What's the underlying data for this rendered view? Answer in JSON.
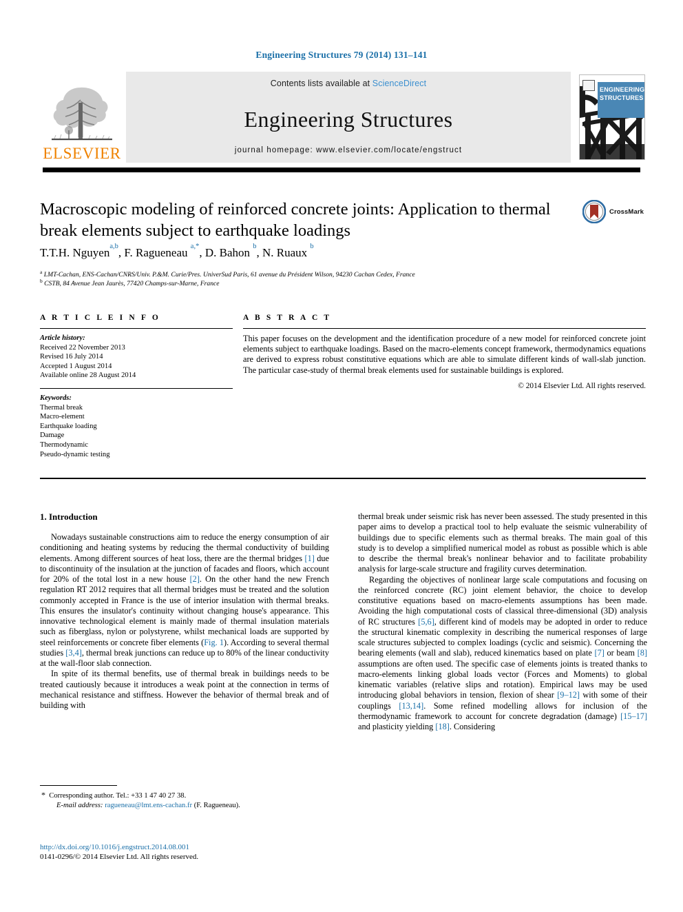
{
  "running_head": "Engineering Structures 79 (2014) 131–141",
  "masthead": {
    "publisher_logo_alt": "elsevier-tree-logo",
    "publisher_name": "ELSEVIER",
    "contents_prefix": "Contents lists available at ",
    "contents_link": "ScienceDirect",
    "journal_title": "Engineering Structures",
    "homepage_line": "journal homepage: www.elsevier.com/locate/engstruct",
    "cover_title_line1": "ENGINEERING",
    "cover_title_line2": "STRUCTURES"
  },
  "article": {
    "title": "Macroscopic modeling of reinforced concrete joints: Application to thermal break elements subject to earthquake loadings",
    "crossmark_label": "CrossMark",
    "authors_html": "T.T.H. Nguyen<sup>a,b</sup>, F. Ragueneau <sup>a,*</sup>, D. Bahon <sup>b</sup>, N. Ruaux <sup>b</sup>",
    "affiliation_a": "LMT-Cachan, ENS-Cachan/CNRS/Univ. P.&M. Curie/Pres. UniverSud Paris, 61 avenue du Président Wilson, 94230 Cachan Cedex, France",
    "affiliation_b": "CSTB, 84 Avenue Jean Jaurès, 77420 Champs-sur-Marne, France"
  },
  "article_info": {
    "heading": "A R T I C L E   I N F O",
    "history_label": "Article history:",
    "history": [
      "Received 22 November 2013",
      "Revised 16 July 2014",
      "Accepted 1 August 2014",
      "Available online 28 August 2014"
    ],
    "keywords_label": "Keywords:",
    "keywords": [
      "Thermal break",
      "Macro-element",
      "Earthquake loading",
      "Damage",
      "Thermodynamic",
      "Pseudo-dynamic testing"
    ]
  },
  "abstract": {
    "heading": "A B S T R A C T",
    "text": "This paper focuses on the development and the identification procedure of a new model for reinforced concrete joint elements subject to earthquake loadings. Based on the macro-elements concept framework, thermodynamics equations are derived to express robust constitutive equations which are able to simulate different kinds of wall-slab junction. The particular case-study of thermal break elements used for sustainable buildings is explored.",
    "copyright": "© 2014 Elsevier Ltd. All rights reserved."
  },
  "body": {
    "section_heading": "1. Introduction",
    "left_paragraph_1_html": "Nowadays sustainable constructions aim to reduce the energy consumption of air conditioning and heating systems by reducing the thermal conductivity of building elements. Among different sources of heat loss, there are the thermal bridges <span class=\"ref\">[1]</span> due to discontinuity of the insulation at the junction of facades and floors, which account for 20% of the total lost in a new house <span class=\"ref\">[2]</span>. On the other hand the new French regulation RT 2012 requires that all thermal bridges must be treated and the solution commonly accepted in France is the use of interior insulation with thermal breaks. This ensures the insulator's continuity without changing house's appearance. This innovative technological element is mainly made of thermal insulation materials such as fiberglass, nylon or polystyrene, whilst mechanical loads are supported by steel reinforcements or concrete fiber elements (<span class=\"ref\">Fig. 1</span>). According to several thermal studies <span class=\"ref\">[3,4]</span>, thermal break junctions can reduce up to 80% of the linear conductivity at the wall-floor slab connection.",
    "left_paragraph_2_html": "In spite of its thermal benefits, use of thermal break in buildings needs to be treated cautiously because it introduces a weak point at the connection in terms of mechanical resistance and stiffness. However the behavior of thermal break and of building with",
    "right_paragraph_1_html": "thermal break under seismic risk has never been assessed. The study presented in this paper aims to develop a practical tool to help evaluate the seismic vulnerability of buildings due to specific elements such as thermal breaks. The main goal of this study is to develop a simplified numerical model as robust as possible which is able to describe the thermal break's nonlinear behavior and to facilitate probability analysis for large-scale structure and fragility curves determination.",
    "right_paragraph_2_html": "Regarding the objectives of nonlinear large scale computations and focusing on the reinforced concrete (RC) joint element behavior, the choice to develop constitutive equations based on macro-elements assumptions has been made. Avoiding the high computational costs of classical three-dimensional (3D) analysis of RC structures <span class=\"ref\">[5,6]</span>, different kind of models may be adopted in order to reduce the structural kinematic complexity in describing the numerical responses of large scale structures subjected to complex loadings (cyclic and seismic). Concerning the bearing elements (wall and slab), reduced kinematics based on plate <span class=\"ref\">[7]</span> or beam <span class=\"ref\">[8]</span> assumptions are often used. The specific case of elements joints is treated thanks to macro-elements linking global loads vector (Forces and Moments) to global kinematic variables (relative slips and rotation). Empirical laws may be used introducing global behaviors in tension, flexion of shear <span class=\"ref\">[9–12]</span> with some of their couplings <span class=\"ref\">[13,14]</span>. Some refined modelling allows for inclusion of the thermodynamic framework to account for concrete degradation (damage) <span class=\"ref\">[15–17]</span> and plasticity yielding <span class=\"ref\">[18]</span>. Considering"
  },
  "footnote": {
    "corresponding_html": "<span style=\"font-size:12px\">*</span>&nbsp; Corresponding author. Tel.: +33 1 47 40 27 38.",
    "email_html": "<span class=\"em\">E-mail address:</span> <span class=\"mail\">ragueneau@lmt.ens-cachan.fr</span> (F. Ragueneau)."
  },
  "footer": {
    "doi": "http://dx.doi.org/10.1016/j.engstruct.2014.08.001",
    "issn": "0141-0296/© 2014 Elsevier Ltd. All rights reserved."
  },
  "colors": {
    "link_blue": "#1a6fa8",
    "sciencedirect_blue": "#3b8fcf",
    "elsevier_orange": "#ef8200",
    "cover_band": "#4a87b5",
    "masthead_gray": "#e9e9e9"
  }
}
